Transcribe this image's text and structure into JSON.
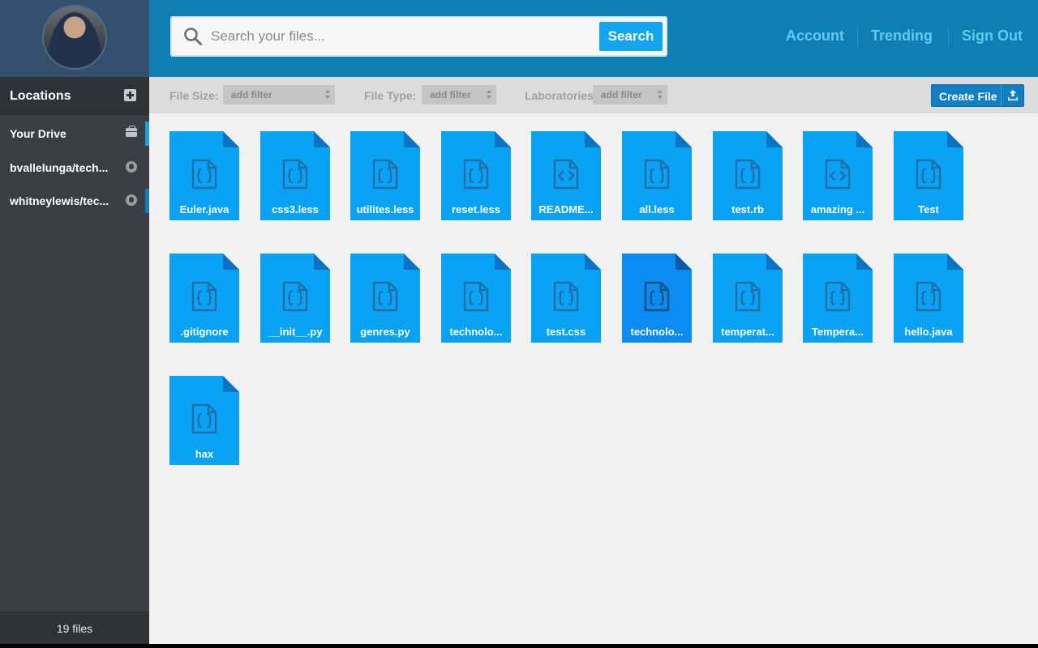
{
  "sidebar": {
    "locations_title": "Locations",
    "items": [
      {
        "label": "Your Drive",
        "icon": "briefcase-icon",
        "active": true
      },
      {
        "label": "bvallelunga/tech...",
        "icon": "github-icon",
        "active": false
      },
      {
        "label": "whitneylewis/tec...",
        "icon": "github-icon",
        "active": true
      }
    ],
    "file_count": "19 files"
  },
  "header": {
    "search_placeholder": "Search your files...",
    "search_button": "Search",
    "nav": [
      "Account",
      "Trending",
      "Sign Out"
    ]
  },
  "filters": {
    "file_size_label": "File Size:",
    "file_type_label": "File Type:",
    "laboratories_label": "Laboratories:",
    "placeholder": "add filter",
    "create_file": "Create File"
  },
  "files": [
    {
      "name": "Euler.java",
      "icon": "braces-icon",
      "selected": false
    },
    {
      "name": "css3.less",
      "icon": "braces-icon",
      "selected": false
    },
    {
      "name": "utilites.less",
      "icon": "braces-icon",
      "selected": false
    },
    {
      "name": "reset.less",
      "icon": "braces-icon",
      "selected": false
    },
    {
      "name": "README...",
      "icon": "code-icon",
      "selected": false
    },
    {
      "name": "all.less",
      "icon": "braces-icon",
      "selected": false
    },
    {
      "name": "test.rb",
      "icon": "braces-icon",
      "selected": false
    },
    {
      "name": "amazing ...",
      "icon": "code-icon",
      "selected": false
    },
    {
      "name": "Test",
      "icon": "braces-icon",
      "selected": false
    },
    {
      "name": ".gitignore",
      "icon": "braces-icon",
      "selected": false
    },
    {
      "name": "__init__.py",
      "icon": "braces-icon",
      "selected": false
    },
    {
      "name": "genres.py",
      "icon": "braces-icon",
      "selected": false
    },
    {
      "name": "technolo...",
      "icon": "braces-icon",
      "selected": false
    },
    {
      "name": "test.css",
      "icon": "braces-icon",
      "selected": false
    },
    {
      "name": "technolo...",
      "icon": "braces-icon",
      "selected": true
    },
    {
      "name": "temperat...",
      "icon": "braces-icon",
      "selected": false
    },
    {
      "name": "Tempera...",
      "icon": "braces-icon",
      "selected": false
    },
    {
      "name": "hello.java",
      "icon": "braces-icon",
      "selected": false
    },
    {
      "name": "hax",
      "icon": "braces-icon",
      "selected": false
    }
  ],
  "colors": {
    "tile": "#0aa2f5",
    "tile_selected": "#0a8cf2",
    "tile_fold": "#0a74c4",
    "glyph": "#1e6fa8",
    "glyph_selected": "#1a4f86",
    "header_bg": "#0e7fb2",
    "nav_text": "#63c8f2"
  }
}
